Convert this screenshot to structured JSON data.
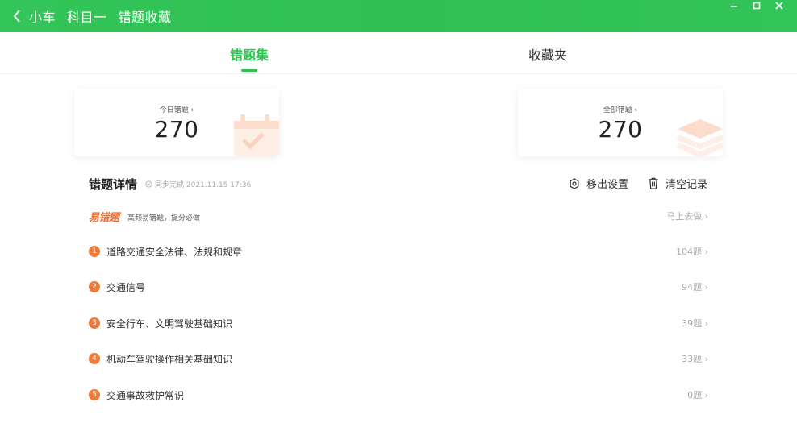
{
  "titlebar": {
    "crumbs": [
      "小车",
      "科目一",
      "错题收藏"
    ],
    "color": "#2fbf52"
  },
  "tabs": [
    {
      "label": "错题集",
      "active": true
    },
    {
      "label": "收藏夹",
      "active": false
    }
  ],
  "stats": {
    "today": {
      "label": "今日错题",
      "value": "270"
    },
    "total": {
      "label": "全部错题",
      "value": "270"
    }
  },
  "details": {
    "title": "错题详情",
    "sync": "同步完成 2021.11.15 17:36",
    "actions": {
      "settings": "移出设置",
      "clear": "清空记录"
    }
  },
  "easy": {
    "logo": "易错题",
    "desc": "高频易错题，提分必做",
    "action": "马上去做"
  },
  "chapters": [
    {
      "num": "1",
      "name": "道路交通安全法律、法规和规章",
      "count": "104题"
    },
    {
      "num": "2",
      "name": "交通信号",
      "count": "94题"
    },
    {
      "num": "3",
      "name": "安全行车、文明驾驶基础知识",
      "count": "39题"
    },
    {
      "num": "4",
      "name": "机动车驾驶操作相关基础知识",
      "count": "33题"
    },
    {
      "num": "5",
      "name": "交通事故救护常识",
      "count": "0题"
    }
  ],
  "icons": {
    "back": "chevron-left-icon",
    "minimize": "minimize-icon",
    "maximize": "maximize-icon",
    "close": "close-icon",
    "settings": "gear-icon",
    "clear": "trash-icon",
    "chevron": "chevron-right-icon"
  },
  "colors": {
    "accent": "#2fbf52",
    "badge": "#f07a3a"
  }
}
